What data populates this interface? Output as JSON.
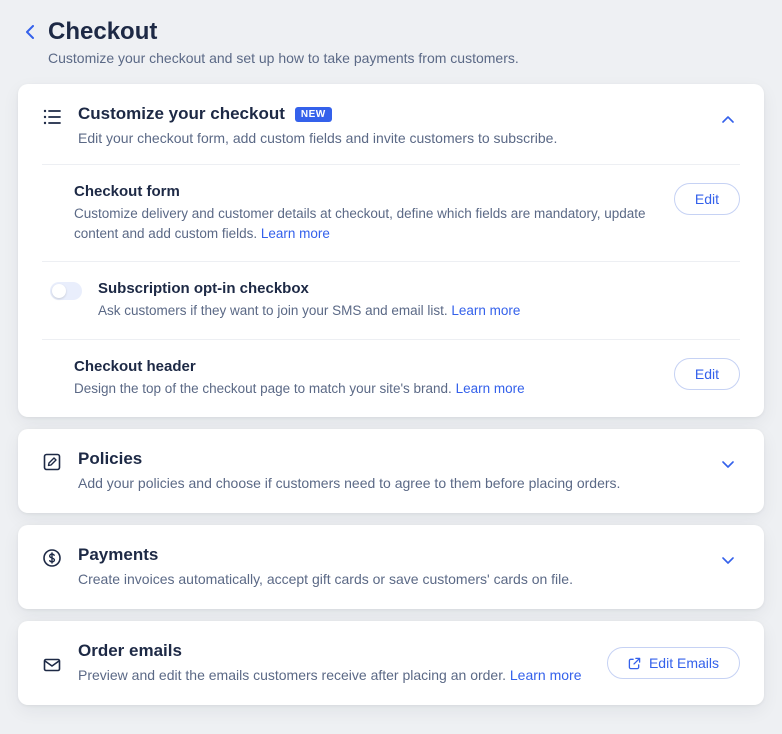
{
  "header": {
    "title": "Checkout",
    "subtitle": "Customize your checkout and set up how to take payments from customers."
  },
  "sections": {
    "customize": {
      "title": "Customize your checkout",
      "badge": "NEW",
      "desc": "Edit your checkout form, add custom fields and invite customers to subscribe.",
      "items": {
        "form": {
          "title": "Checkout form",
          "desc": "Customize delivery and customer details at checkout, define which fields are mandatory, update content and add custom fields. ",
          "learn": "Learn more",
          "edit": "Edit"
        },
        "subscription": {
          "title": "Subscription opt-in checkbox",
          "desc": "Ask customers if they want to join your SMS and email list. ",
          "learn": "Learn more"
        },
        "headerRow": {
          "title": "Checkout header",
          "desc": "Design the top of the checkout page to match your site's brand. ",
          "learn": "Learn more",
          "edit": "Edit"
        }
      }
    },
    "policies": {
      "title": "Policies",
      "desc": "Add your policies and choose if customers need to agree to them before placing orders."
    },
    "payments": {
      "title": "Payments",
      "desc": "Create invoices automatically, accept gift cards or save customers' cards on file."
    },
    "emails": {
      "title": "Order emails",
      "desc": "Preview and edit the emails customers receive after placing an order. ",
      "learn": "Learn more",
      "button": "Edit Emails"
    }
  }
}
